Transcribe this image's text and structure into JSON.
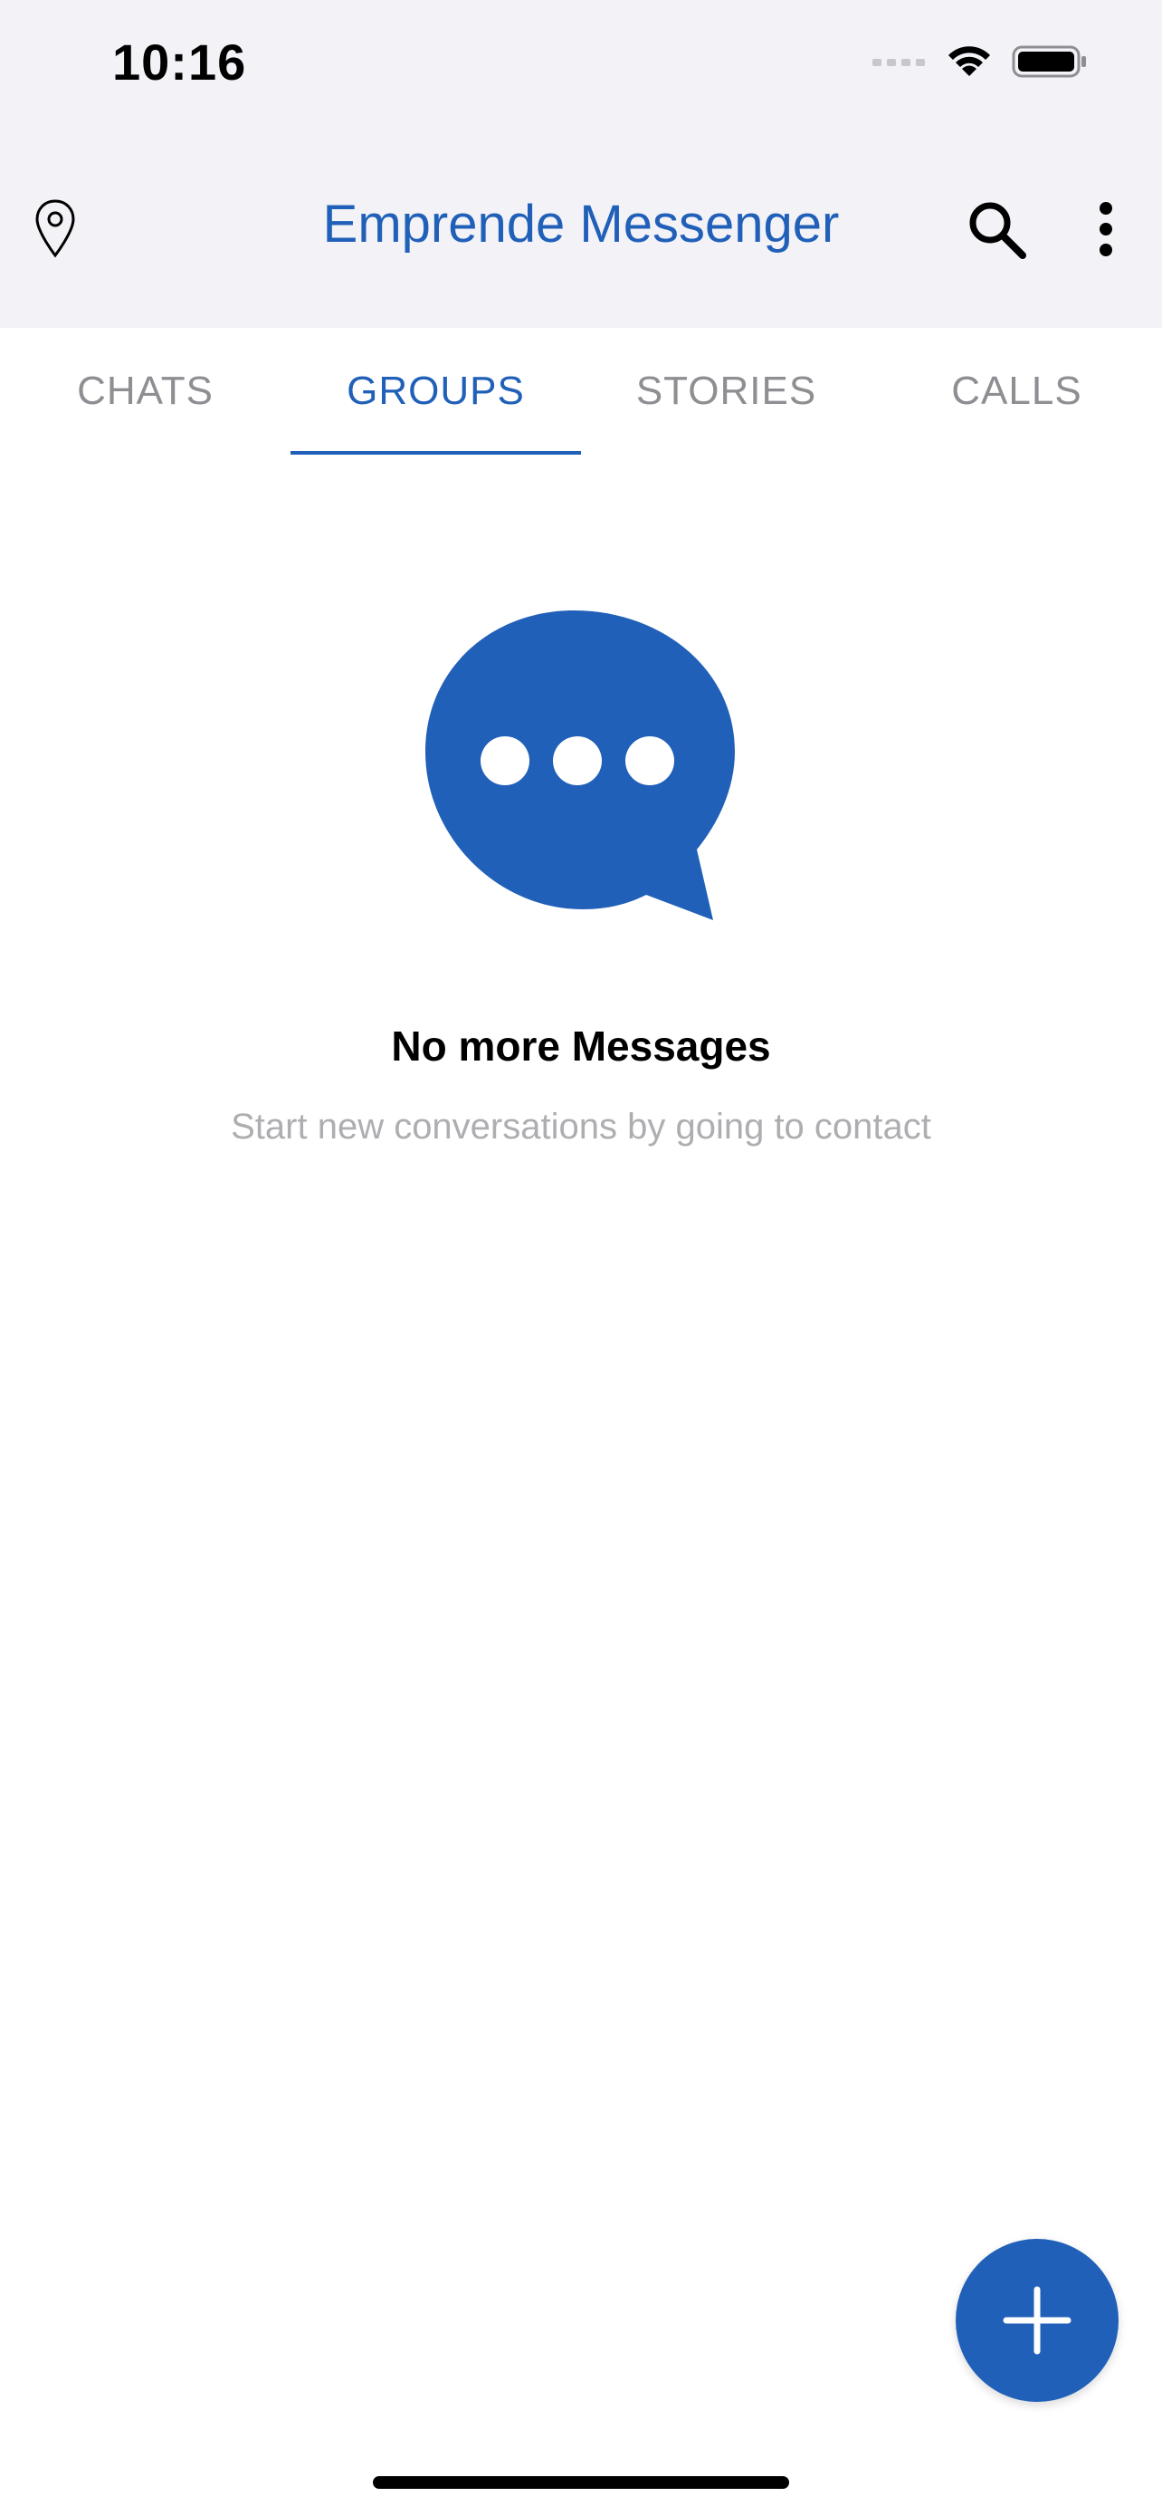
{
  "status_bar": {
    "time": "10:16",
    "icons": [
      "signal-icon",
      "wifi-icon",
      "battery-icon"
    ]
  },
  "header": {
    "title": "Emprende Messenger",
    "left_icon": "location-pin-icon",
    "right_icons": [
      "search-icon",
      "more-vertical-icon"
    ]
  },
  "tabs": [
    {
      "label": "CHATS",
      "active": false
    },
    {
      "label": "GROUPS",
      "active": true
    },
    {
      "label": "STORIES",
      "active": false
    },
    {
      "label": "CALLS",
      "active": false
    }
  ],
  "empty_state": {
    "icon": "chat-bubble-icon",
    "title": "No more Messages",
    "subtitle": "Start new conversations by going to contact"
  },
  "fab": {
    "icon": "plus-icon"
  },
  "colors": {
    "accent": "#2160b8",
    "header_bg": "#f2f2f7",
    "tab_inactive": "#8e8e93",
    "subtitle": "#aeaeb2"
  }
}
